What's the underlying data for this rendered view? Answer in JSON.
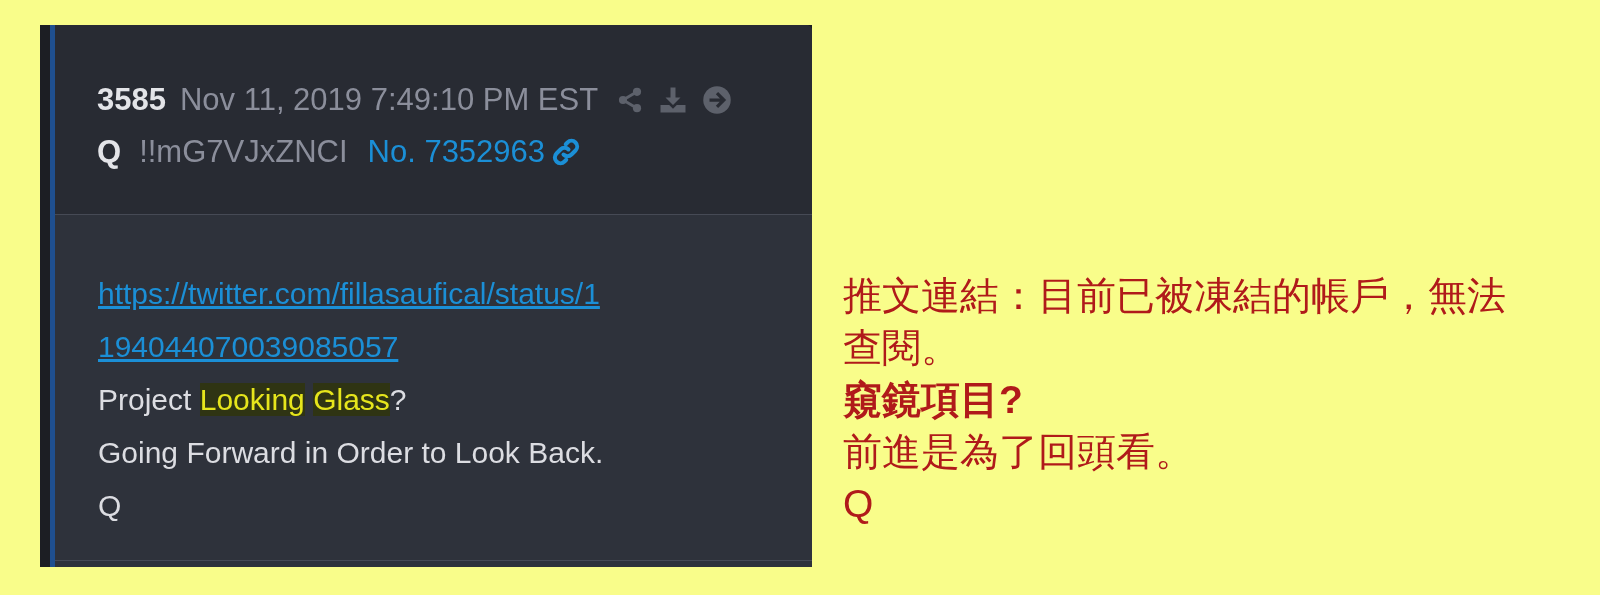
{
  "post": {
    "number": "3585",
    "timestamp": "Nov 11, 2019 7:49:10 PM EST",
    "author": "Q",
    "tripcode": "!!mG7VJxZNCI",
    "post_no": "No. 7352963",
    "link": "https://twitter.com/fillasaufical/status/1194044070039085057",
    "lines": [
      [
        {
          "text": "Project ",
          "highlighted": false
        },
        {
          "text": "Looking ",
          "highlighted": true
        },
        {
          "text": "Glass",
          "highlighted": true
        },
        {
          "text": "?",
          "highlighted": false
        }
      ],
      [
        {
          "text": "Going Forward in Order to Look Back.",
          "highlighted": false
        }
      ],
      [
        {
          "text": "Q",
          "highlighted": false
        }
      ]
    ]
  },
  "annotation": [
    {
      "text": "推文連結：目前已被凍結的帳戶，無法查閱。",
      "bold": false
    },
    {
      "text": "窺鏡項目?",
      "bold": true
    },
    {
      "text": "前進是為了回頭看。",
      "bold": false
    },
    {
      "text": "Q",
      "bold": false
    }
  ]
}
